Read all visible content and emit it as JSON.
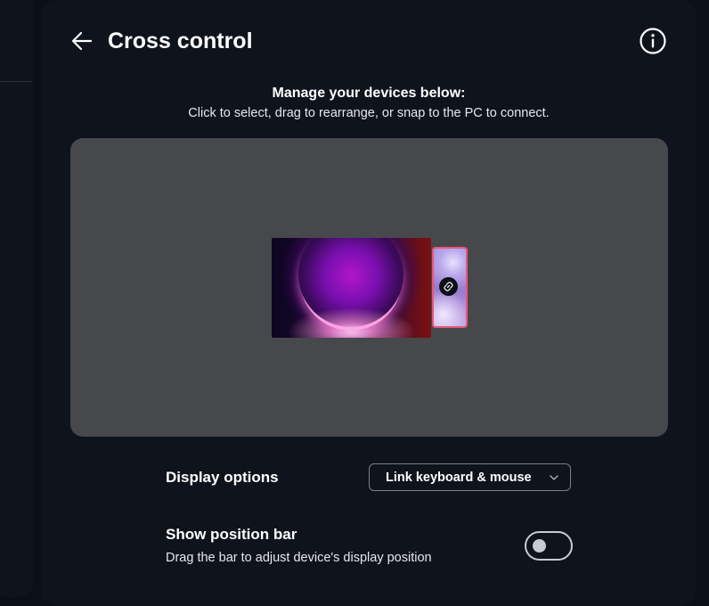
{
  "header": {
    "title": "Cross control",
    "back_icon": "arrow-left-icon",
    "info_icon": "info-circle-icon"
  },
  "instructions": {
    "title": "Manage your devices below:",
    "subtitle": "Click to select, drag to rearrange, or snap to the PC to connect."
  },
  "arrangement": {
    "devices": [
      {
        "name": "PC display",
        "icon": "pc-screen"
      },
      {
        "name": "Phone",
        "icon": "phone-screen",
        "selected": true,
        "linked": true
      }
    ],
    "link_icon": "link-icon",
    "colors": {
      "canvas": "#47484c",
      "selected_border": "#e8577a"
    }
  },
  "settings": {
    "display_options": {
      "label": "Display options",
      "value": "Link keyboard & mouse"
    },
    "position_bar": {
      "label": "Show position bar",
      "description": "Drag the bar to adjust device's display position",
      "enabled": false
    }
  }
}
